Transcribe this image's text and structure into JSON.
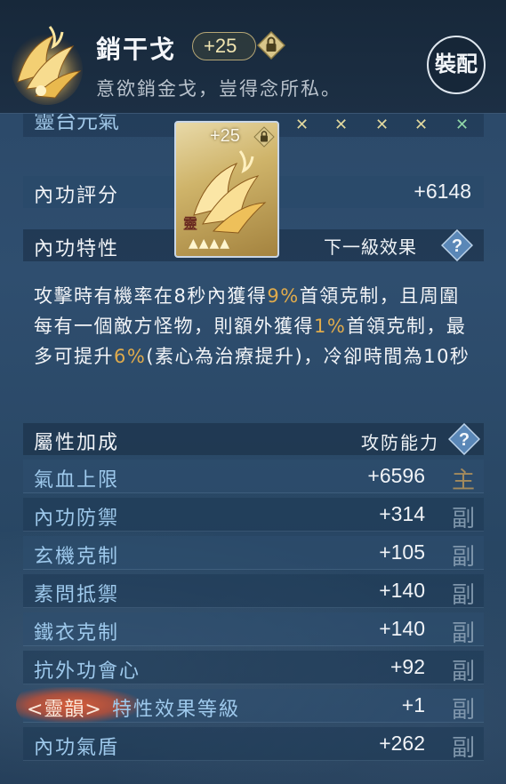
{
  "header": {
    "item_name": "銷干戈",
    "level_badge": "+25",
    "flavor_text": "意欲銷金戈，豈得念所私。",
    "equip_button": "裝配"
  },
  "cut_row": {
    "label": "靈台元氣"
  },
  "rating": {
    "label": "內功評分",
    "value": "+6148"
  },
  "card": {
    "level": "+25",
    "tag": "靈",
    "stars": "▲▲▲▲"
  },
  "trait": {
    "label": "內功特性",
    "next_label": "下一級效果",
    "desc_parts": {
      "p1": "攻擊時有機率在8秒內獲得",
      "h1": "9%",
      "p2": "首領克制，且周圍每有一個敵方怪物，則額外獲得",
      "h2": "1%",
      "p3": "首領克制，最多可提升",
      "h3": "6%",
      "p4": "(素心為治療提升)，冷卻時間為10秒"
    }
  },
  "attributes": {
    "title": "屬性加成",
    "right_label": "攻防能力",
    "rows": [
      {
        "name": "氣血上限",
        "value": "+6596",
        "tag": "主"
      },
      {
        "name": "內功防禦",
        "value": "+314",
        "tag": "副"
      },
      {
        "name": "玄機克制",
        "value": "+105",
        "tag": "副"
      },
      {
        "name": "素問抵禦",
        "value": "+140",
        "tag": "副"
      },
      {
        "name": "鐵衣克制",
        "value": "+140",
        "tag": "副"
      },
      {
        "name": "抗外功會心",
        "value": "+92",
        "tag": "副"
      },
      {
        "name_prefix": "<靈韻>",
        "name": "特性效果等級",
        "value": "+1",
        "tag": "副"
      },
      {
        "name": "內功氣盾",
        "value": "+262",
        "tag": "副"
      }
    ]
  },
  "colors": {
    "highlight": "#e0ab4c",
    "attr_name": "#9ec9ec",
    "lingyun_glow": "#e05f37"
  },
  "icons": [
    "golden-feather-fan-icon",
    "lock-icon",
    "help-icon"
  ]
}
